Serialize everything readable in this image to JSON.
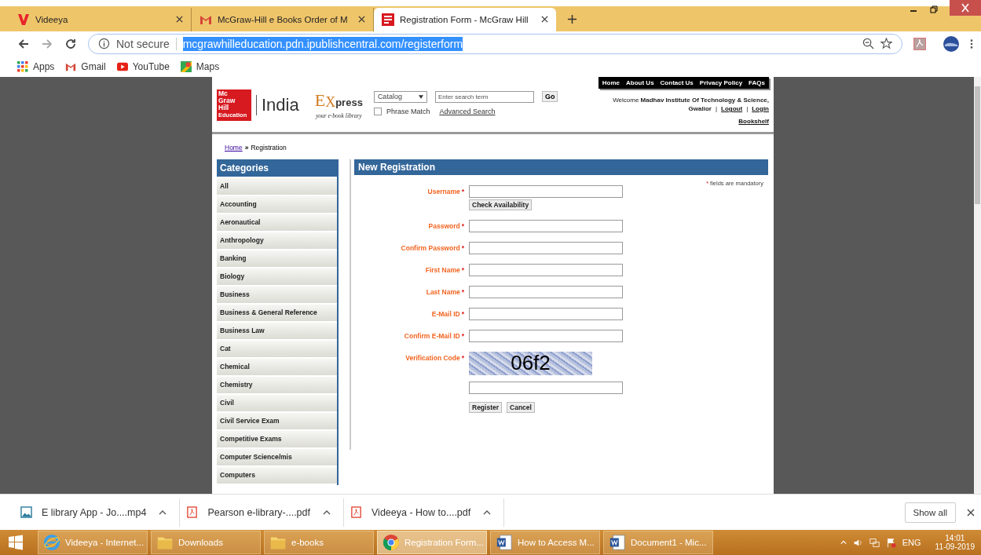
{
  "browser": {
    "tabs": [
      {
        "title": "Videeya",
        "selected": false
      },
      {
        "title": "McGraw-Hill e Books Order of M",
        "selected": false
      },
      {
        "title": "Registration Form - McGraw Hill",
        "selected": true
      }
    ],
    "address": {
      "security": "Not secure",
      "url": "mcgrawhilleducation.pdn.ipublishcentral.com/registerform"
    },
    "bookmarks": [
      {
        "label": "Apps"
      },
      {
        "label": "Gmail"
      },
      {
        "label": "YouTube"
      },
      {
        "label": "Maps"
      }
    ]
  },
  "site": {
    "logo": {
      "brand_lines": [
        "Mc",
        "Graw",
        "Hill",
        "Education"
      ],
      "region": "India",
      "express_e": "E",
      "express_x": "X",
      "express_rest": "press",
      "tagline": "your e-book library"
    },
    "top_nav": [
      "Home",
      "About Us",
      "Contact Us",
      "Privacy Policy",
      "FAQs"
    ],
    "search": {
      "scope": "Catalog",
      "placeholder": "Enter search term",
      "button": "Go",
      "phrase_match": {
        "label": "Phrase Match",
        "checked": false
      },
      "advanced": "Advanced Search"
    },
    "welcome": {
      "text": "Welcome **Madhav Institute Of Technology & Science,**",
      "place": "Gwalior",
      "separator": "|",
      "links": [
        "Logout",
        "Login"
      ],
      "bookshelf": "Bookshelf"
    },
    "breadcrumb": {
      "separator": "»",
      "items": [
        {
          "label": "Home",
          "link": true
        },
        {
          "label": "Registration",
          "link": false
        }
      ]
    },
    "categories": {
      "title": "Categories",
      "items": [
        "All",
        "Accounting",
        "Aeronautical",
        "Anthropology",
        "Banking",
        "Biology",
        "Business",
        "Business & General Reference",
        "Business Law",
        "Cat",
        "Chemical",
        "Chemistry",
        "Civil",
        "Civil Service Exam",
        "Competitive Exams",
        "Computer Science/mis",
        "Computers"
      ]
    },
    "form": {
      "title": "New Registration",
      "note_mark": "*",
      "note": "fields are mandatory",
      "fields": [
        {
          "kind": "text",
          "label": "Username",
          "mark": "*",
          "button": "Check Availability"
        },
        {
          "kind": "text",
          "label": "Password",
          "mark": "*"
        },
        {
          "kind": "text",
          "label": "Confirm Password",
          "mark": "*"
        },
        {
          "kind": "text",
          "label": "First Name",
          "mark": "*"
        },
        {
          "kind": "text",
          "label": "Last Name",
          "mark": "*"
        },
        {
          "kind": "text",
          "label": "E-Mail ID",
          "mark": "*"
        },
        {
          "kind": "text",
          "label": "Confirm E-Mail ID",
          "mark": "*"
        },
        {
          "kind": "captcha",
          "label": "Verification Code",
          "mark": "*",
          "code": "06f2"
        }
      ],
      "buttons": [
        "Register",
        "Cancel"
      ]
    }
  },
  "downloads": {
    "items": [
      {
        "name": "E library App - Jo....mp4"
      },
      {
        "name": "Pearson e-library-....pdf"
      },
      {
        "name": "Videeya - How to....pdf"
      }
    ],
    "show_all": "Show all"
  },
  "taskbar": {
    "items": [
      {
        "label": "Videeya - Internet...",
        "selected": false
      },
      {
        "label": "Downloads",
        "selected": false
      },
      {
        "label": "e-books",
        "selected": false
      },
      {
        "label": "Registration Form...",
        "selected": true
      },
      {
        "label": "How to Access M...",
        "selected": false
      },
      {
        "label": "Document1 - Mic...",
        "selected": false
      }
    ],
    "language": "ENG",
    "time": "14:01",
    "date": "11-09-2019"
  }
}
